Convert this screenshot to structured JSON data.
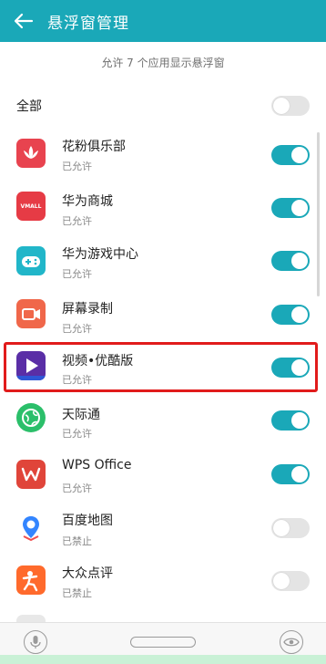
{
  "header": {
    "title": "悬浮窗管理",
    "back_icon": "arrow-left-icon",
    "color": "#1aa8b8"
  },
  "subtitle": "允许 7 个应用显示悬浮窗",
  "all_toggle": {
    "label": "全部",
    "on": false
  },
  "apps": [
    {
      "name": "花粉俱乐部",
      "status": "已允许",
      "on": true,
      "icon": "lotus-icon"
    },
    {
      "name": "华为商城",
      "status": "已允许",
      "on": true,
      "icon": "vmall-icon",
      "icon_text": "VMALL"
    },
    {
      "name": "华为游戏中心",
      "status": "已允许",
      "on": true,
      "icon": "gamepad-icon"
    },
    {
      "name": "屏幕录制",
      "status": "已允许",
      "on": true,
      "icon": "video-camera-icon"
    },
    {
      "name": "视频•优酷版",
      "status": "已允许",
      "on": true,
      "icon": "play-icon",
      "highlighted": true
    },
    {
      "name": "天际通",
      "status": "已允许",
      "on": true,
      "icon": "globe-icon"
    },
    {
      "name": "WPS Office",
      "status": "已允许",
      "on": true,
      "icon": "wps-icon"
    },
    {
      "name": "百度地图",
      "status": "已禁止",
      "on": false,
      "icon": "map-pin-icon"
    },
    {
      "name": "大众点评",
      "status": "已禁止",
      "on": false,
      "icon": "person-icon"
    }
  ],
  "colors": {
    "accent": "#1aa8b8",
    "highlight_border": "#e11b1b",
    "toggle_off": "#e4e4e4"
  }
}
